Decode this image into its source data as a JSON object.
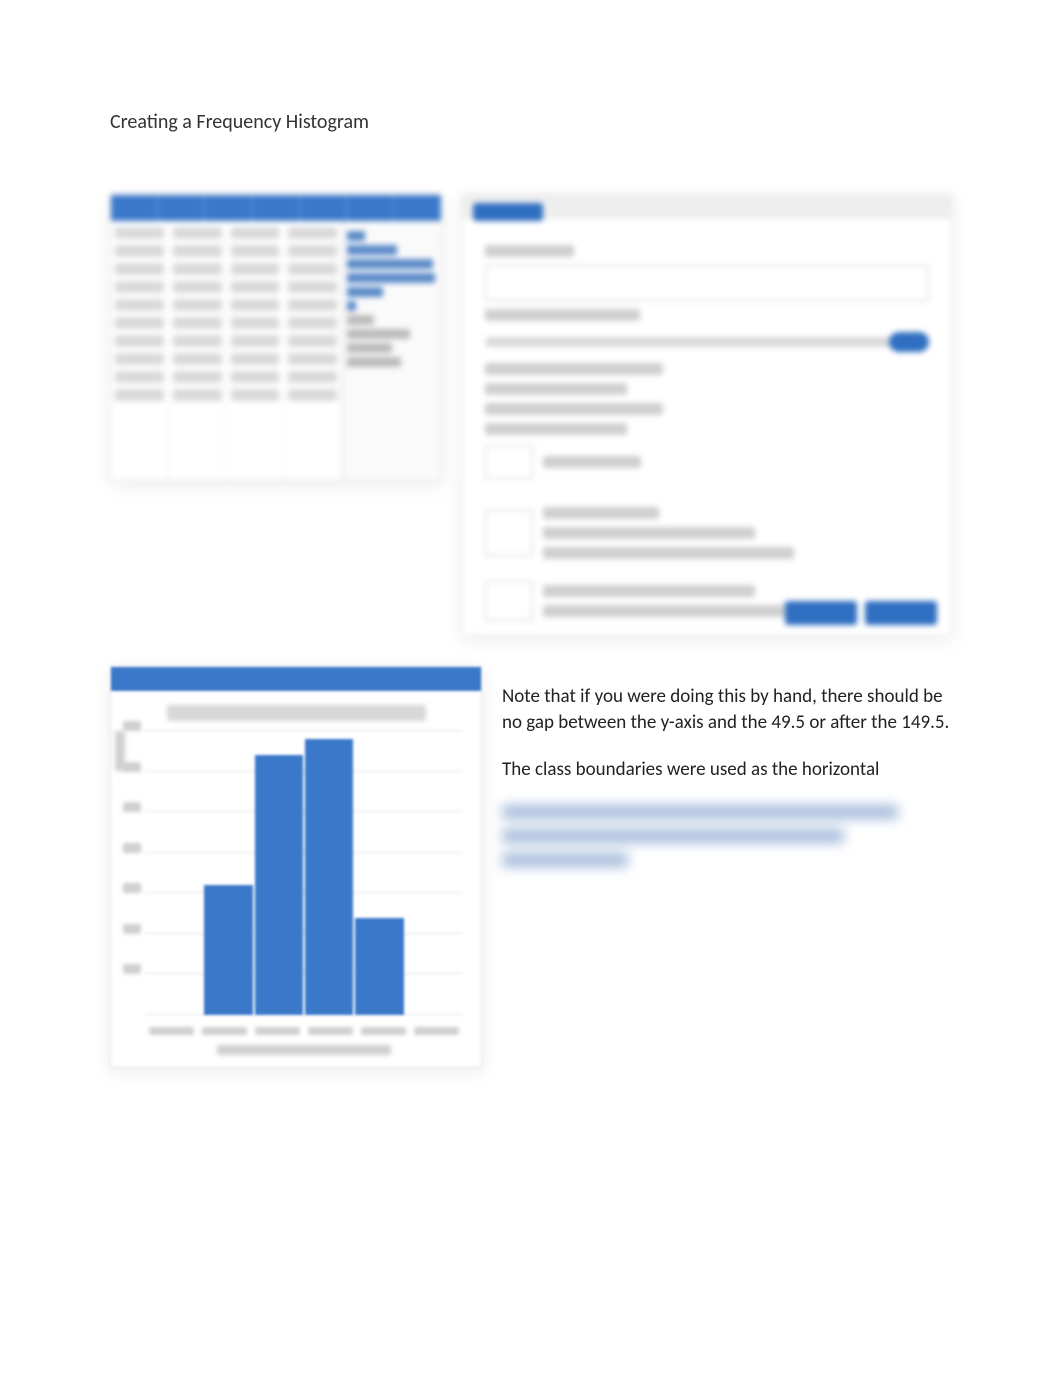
{
  "title": "Creating a Frequency Histogram",
  "note1": "Note that if you were doing this by hand, there should be no gap between the y-axis and the 49.5 or after the 149.5.",
  "note2": "The class boundaries were used as the horizontal",
  "chart_data": {
    "type": "bar",
    "title": "",
    "xlabel": "Class Boundaries",
    "ylabel": "Frequency",
    "categories": [
      "49.5",
      "69.5",
      "89.5",
      "109.5",
      "129.5",
      "149.5"
    ],
    "values": [
      0,
      16,
      32,
      34,
      12,
      0
    ],
    "ylim": [
      0,
      35
    ],
    "yticks": [
      0,
      5,
      10,
      15,
      20,
      25,
      30,
      35
    ]
  }
}
